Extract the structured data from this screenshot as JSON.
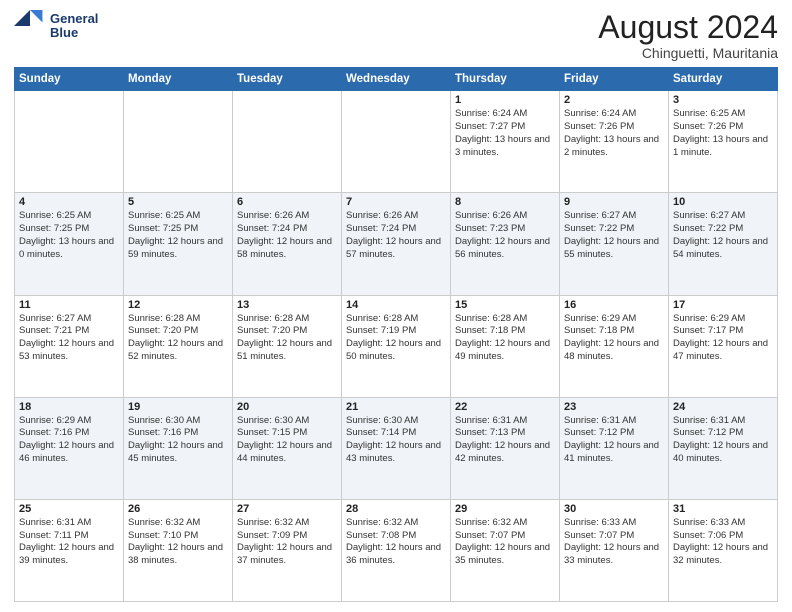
{
  "header": {
    "logo_line1": "General",
    "logo_line2": "Blue",
    "month_title": "August 2024",
    "location": "Chinguetti, Mauritania"
  },
  "days_of_week": [
    "Sunday",
    "Monday",
    "Tuesday",
    "Wednesday",
    "Thursday",
    "Friday",
    "Saturday"
  ],
  "weeks": [
    [
      {
        "day": "",
        "info": ""
      },
      {
        "day": "",
        "info": ""
      },
      {
        "day": "",
        "info": ""
      },
      {
        "day": "",
        "info": ""
      },
      {
        "day": "1",
        "info": "Sunrise: 6:24 AM\nSunset: 7:27 PM\nDaylight: 13 hours\nand 3 minutes."
      },
      {
        "day": "2",
        "info": "Sunrise: 6:24 AM\nSunset: 7:26 PM\nDaylight: 13 hours\nand 2 minutes."
      },
      {
        "day": "3",
        "info": "Sunrise: 6:25 AM\nSunset: 7:26 PM\nDaylight: 13 hours\nand 1 minute."
      }
    ],
    [
      {
        "day": "4",
        "info": "Sunrise: 6:25 AM\nSunset: 7:25 PM\nDaylight: 13 hours\nand 0 minutes."
      },
      {
        "day": "5",
        "info": "Sunrise: 6:25 AM\nSunset: 7:25 PM\nDaylight: 12 hours\nand 59 minutes."
      },
      {
        "day": "6",
        "info": "Sunrise: 6:26 AM\nSunset: 7:24 PM\nDaylight: 12 hours\nand 58 minutes."
      },
      {
        "day": "7",
        "info": "Sunrise: 6:26 AM\nSunset: 7:24 PM\nDaylight: 12 hours\nand 57 minutes."
      },
      {
        "day": "8",
        "info": "Sunrise: 6:26 AM\nSunset: 7:23 PM\nDaylight: 12 hours\nand 56 minutes."
      },
      {
        "day": "9",
        "info": "Sunrise: 6:27 AM\nSunset: 7:22 PM\nDaylight: 12 hours\nand 55 minutes."
      },
      {
        "day": "10",
        "info": "Sunrise: 6:27 AM\nSunset: 7:22 PM\nDaylight: 12 hours\nand 54 minutes."
      }
    ],
    [
      {
        "day": "11",
        "info": "Sunrise: 6:27 AM\nSunset: 7:21 PM\nDaylight: 12 hours\nand 53 minutes."
      },
      {
        "day": "12",
        "info": "Sunrise: 6:28 AM\nSunset: 7:20 PM\nDaylight: 12 hours\nand 52 minutes."
      },
      {
        "day": "13",
        "info": "Sunrise: 6:28 AM\nSunset: 7:20 PM\nDaylight: 12 hours\nand 51 minutes."
      },
      {
        "day": "14",
        "info": "Sunrise: 6:28 AM\nSunset: 7:19 PM\nDaylight: 12 hours\nand 50 minutes."
      },
      {
        "day": "15",
        "info": "Sunrise: 6:28 AM\nSunset: 7:18 PM\nDaylight: 12 hours\nand 49 minutes."
      },
      {
        "day": "16",
        "info": "Sunrise: 6:29 AM\nSunset: 7:18 PM\nDaylight: 12 hours\nand 48 minutes."
      },
      {
        "day": "17",
        "info": "Sunrise: 6:29 AM\nSunset: 7:17 PM\nDaylight: 12 hours\nand 47 minutes."
      }
    ],
    [
      {
        "day": "18",
        "info": "Sunrise: 6:29 AM\nSunset: 7:16 PM\nDaylight: 12 hours\nand 46 minutes."
      },
      {
        "day": "19",
        "info": "Sunrise: 6:30 AM\nSunset: 7:16 PM\nDaylight: 12 hours\nand 45 minutes."
      },
      {
        "day": "20",
        "info": "Sunrise: 6:30 AM\nSunset: 7:15 PM\nDaylight: 12 hours\nand 44 minutes."
      },
      {
        "day": "21",
        "info": "Sunrise: 6:30 AM\nSunset: 7:14 PM\nDaylight: 12 hours\nand 43 minutes."
      },
      {
        "day": "22",
        "info": "Sunrise: 6:31 AM\nSunset: 7:13 PM\nDaylight: 12 hours\nand 42 minutes."
      },
      {
        "day": "23",
        "info": "Sunrise: 6:31 AM\nSunset: 7:12 PM\nDaylight: 12 hours\nand 41 minutes."
      },
      {
        "day": "24",
        "info": "Sunrise: 6:31 AM\nSunset: 7:12 PM\nDaylight: 12 hours\nand 40 minutes."
      }
    ],
    [
      {
        "day": "25",
        "info": "Sunrise: 6:31 AM\nSunset: 7:11 PM\nDaylight: 12 hours\nand 39 minutes."
      },
      {
        "day": "26",
        "info": "Sunrise: 6:32 AM\nSunset: 7:10 PM\nDaylight: 12 hours\nand 38 minutes."
      },
      {
        "day": "27",
        "info": "Sunrise: 6:32 AM\nSunset: 7:09 PM\nDaylight: 12 hours\nand 37 minutes."
      },
      {
        "day": "28",
        "info": "Sunrise: 6:32 AM\nSunset: 7:08 PM\nDaylight: 12 hours\nand 36 minutes."
      },
      {
        "day": "29",
        "info": "Sunrise: 6:32 AM\nSunset: 7:07 PM\nDaylight: 12 hours\nand 35 minutes."
      },
      {
        "day": "30",
        "info": "Sunrise: 6:33 AM\nSunset: 7:07 PM\nDaylight: 12 hours\nand 33 minutes."
      },
      {
        "day": "31",
        "info": "Sunrise: 6:33 AM\nSunset: 7:06 PM\nDaylight: 12 hours\nand 32 minutes."
      }
    ]
  ]
}
